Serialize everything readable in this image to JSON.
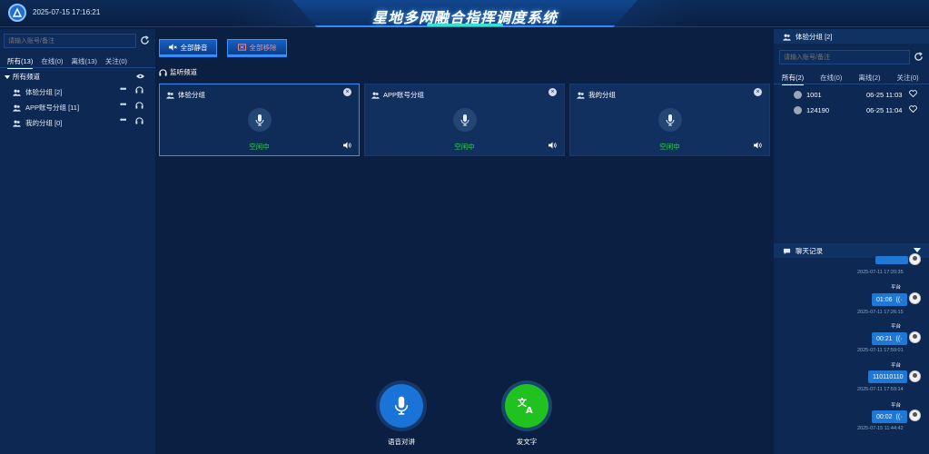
{
  "header": {
    "datetime": "2025-07-15 17:16:21",
    "title": "星地多网融合指挥调度系统"
  },
  "left": {
    "search_placeholder": "请输入账号/备注",
    "tabs": [
      "所有(13)",
      "在线(0)",
      "离线(13)",
      "关注(0)"
    ],
    "root_label": "所有频道",
    "groups": [
      {
        "label": "体验分组 [2]"
      },
      {
        "label": "APP账号分组 [11]"
      },
      {
        "label": "我的分组 [0]"
      }
    ]
  },
  "center": {
    "mute_all": "全部静音",
    "remove_all": "全部移除",
    "monitor_label": "监听频道",
    "cards": [
      {
        "name": "体验分组",
        "status": "空闲中"
      },
      {
        "name": "APP账号分组",
        "status": "空闲中"
      },
      {
        "name": "我的分组",
        "status": "空闲中"
      }
    ],
    "voice_talk": "语音对讲",
    "send_text": "发文字"
  },
  "right": {
    "group_title": "体验分组 [2]",
    "search_placeholder": "请输入账号/备注",
    "tabs": [
      "所有(2)",
      "在线(0)",
      "离线(2)",
      "关注(0)"
    ],
    "users": [
      {
        "id": "1001",
        "time": "06-25 11:03"
      },
      {
        "id": "124190",
        "time": "06-25 11:04"
      }
    ],
    "chat_title": "聊天记录",
    "messages": [
      {
        "time": "2025-07-11 17:20:35"
      },
      {
        "sender": "平台",
        "content": "01:06",
        "time": "2025-07-11 17:26:15"
      },
      {
        "sender": "平台",
        "content": "00:21",
        "time": "2025-07-11 17:59:01"
      },
      {
        "sender": "平台",
        "content": "110110110",
        "time": "2025-07-11 17:59:14"
      },
      {
        "sender": "平台",
        "content": "00:02",
        "time": "2025-07-15 11:44:42"
      }
    ]
  },
  "colors": {
    "background": "#0a1f42",
    "panel": "#0d2853",
    "accent": "#2f8cff",
    "idle_status": "#29d34a",
    "voice_button": "#1a73d6",
    "text_button": "#1fc21f"
  }
}
